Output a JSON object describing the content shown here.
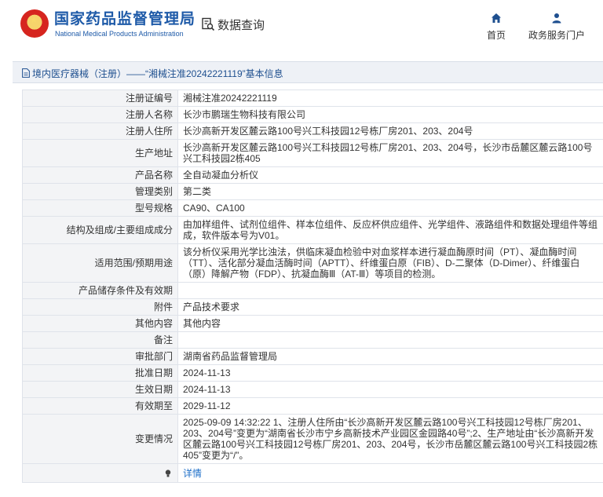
{
  "header": {
    "brand_cn": "国家药品监督管理局",
    "brand_en": "National Medical Products Administration",
    "query_label": "数据查询",
    "nav": [
      {
        "label": "首页",
        "icon": "home-icon"
      },
      {
        "label": "政务服务门户",
        "icon": "user-icon"
      }
    ]
  },
  "page": {
    "title": "境内医疗器械（注册）——“湘械注准20242221119”基本信息"
  },
  "record": {
    "rows": [
      {
        "label": "注册证编号",
        "value": "湘械注准20242221119"
      },
      {
        "label": "注册人名称",
        "value": "长沙市鹏瑞生物科技有限公司"
      },
      {
        "label": "注册人住所",
        "value": "长沙高新开发区麓云路100号兴工科技园12号栋厂房201、203、204号"
      },
      {
        "label": "生产地址",
        "value": "长沙高新开发区麓云路100号兴工科技园12号栋厂房201、203、204号，长沙市岳麓区麓云路100号兴工科技园2栋405"
      },
      {
        "label": "产品名称",
        "value": "全自动凝血分析仪"
      },
      {
        "label": "管理类别",
        "value": "第二类"
      },
      {
        "label": "型号规格",
        "value": "CA90、CA100"
      },
      {
        "label": "结构及组成/主要组成成分",
        "value": "由加样组件、试剂位组件、样本位组件、反应杯供应组件、光学组件、液路组件和数据处理组件等组成，软件版本号为V01。"
      },
      {
        "label": "适用范围/预期用途",
        "value": "该分析仪采用光学比浊法，供临床凝血检验中对血浆样本进行凝血酶原时间（PT）、凝血酶时间（TT）、活化部分凝血活酶时间（APTT）、纤维蛋白原（FIB）、D-二聚体（D-Dimer）、纤维蛋白（原）降解产物（FDP）、抗凝血酶Ⅲ（AT-Ⅲ）等项目的检测。"
      },
      {
        "label": "产品储存条件及有效期",
        "value": ""
      },
      {
        "label": "附件",
        "value": "产品技术要求"
      },
      {
        "label": "其他内容",
        "value": "其他内容"
      },
      {
        "label": "备注",
        "value": ""
      },
      {
        "label": "审批部门",
        "value": "湖南省药品监督管理局"
      },
      {
        "label": "批准日期",
        "value": "2024-11-13"
      },
      {
        "label": "生效日期",
        "value": "2024-11-13"
      },
      {
        "label": "有效期至",
        "value": "2029-11-12"
      },
      {
        "label": "变更情况",
        "value": "2025-09-09 14:32:22 1、注册人住所由“长沙高新开发区麓云路100号兴工科技园12号栋厂房201、203、204号”变更为“湖南省长沙市宁乡高新技术产业园区金园路40号”;2、生产地址由“长沙高新开发区麓云路100号兴工科技园12号栋厂房201、203、204号，长沙市岳麓区麓云路100号兴工科技园2栋405”变更为“/”。"
      }
    ],
    "detail_link": "详情"
  },
  "colors": {
    "brand_blue": "#1e5aa8",
    "label_bg": "#f3f4f6",
    "titlebar_bg": "#eef1f6",
    "link": "#1e6fc8"
  }
}
